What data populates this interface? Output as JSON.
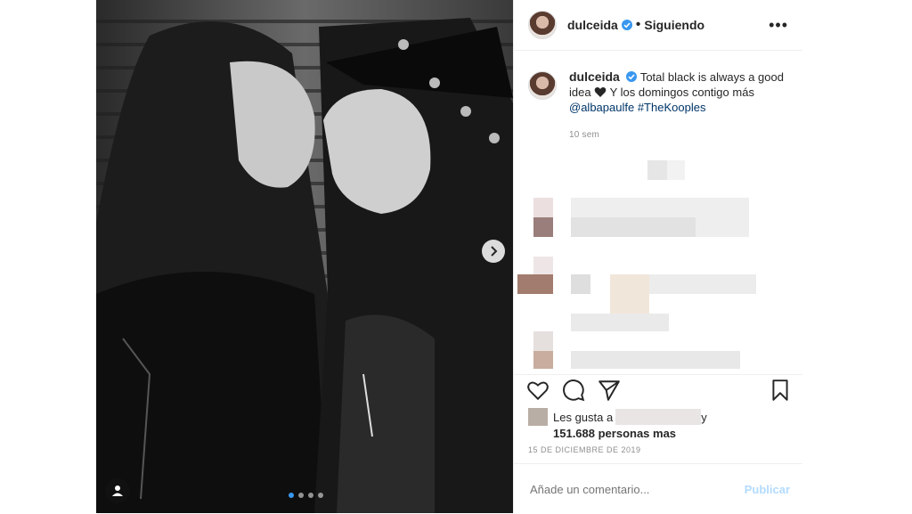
{
  "post": {
    "username": "dulceida",
    "follow_status": "Siguiendo",
    "separator": "•",
    "more_label": "•••",
    "caption": {
      "text_before_heart": "Total black is always a good idea",
      "text_after_heart": "Y los domingos contigo más",
      "mention": "@albapaulfe",
      "hashtag": "#TheKooples"
    },
    "caption_age": "10 sem",
    "likes_prefix": "Les gusta a",
    "likes_suffix": "y",
    "likes_count_text": "151.688 personas mas",
    "date": "15 DE DICIEMBRE DE 2019",
    "comment_placeholder": "Añade un comentario...",
    "publish_label": "Publicar",
    "carousel": {
      "total": 4,
      "active": 0
    }
  },
  "colors": {
    "verified": "#3897f0",
    "link": "#003569",
    "publish_disabled": "#b3dbff",
    "muted": "#8e8e8e"
  },
  "icons": [
    "verified-badge-icon",
    "more-options-icon",
    "heart-icon",
    "comment-icon",
    "share-icon",
    "bookmark-icon",
    "chevron-right-icon",
    "user-tag-icon"
  ]
}
